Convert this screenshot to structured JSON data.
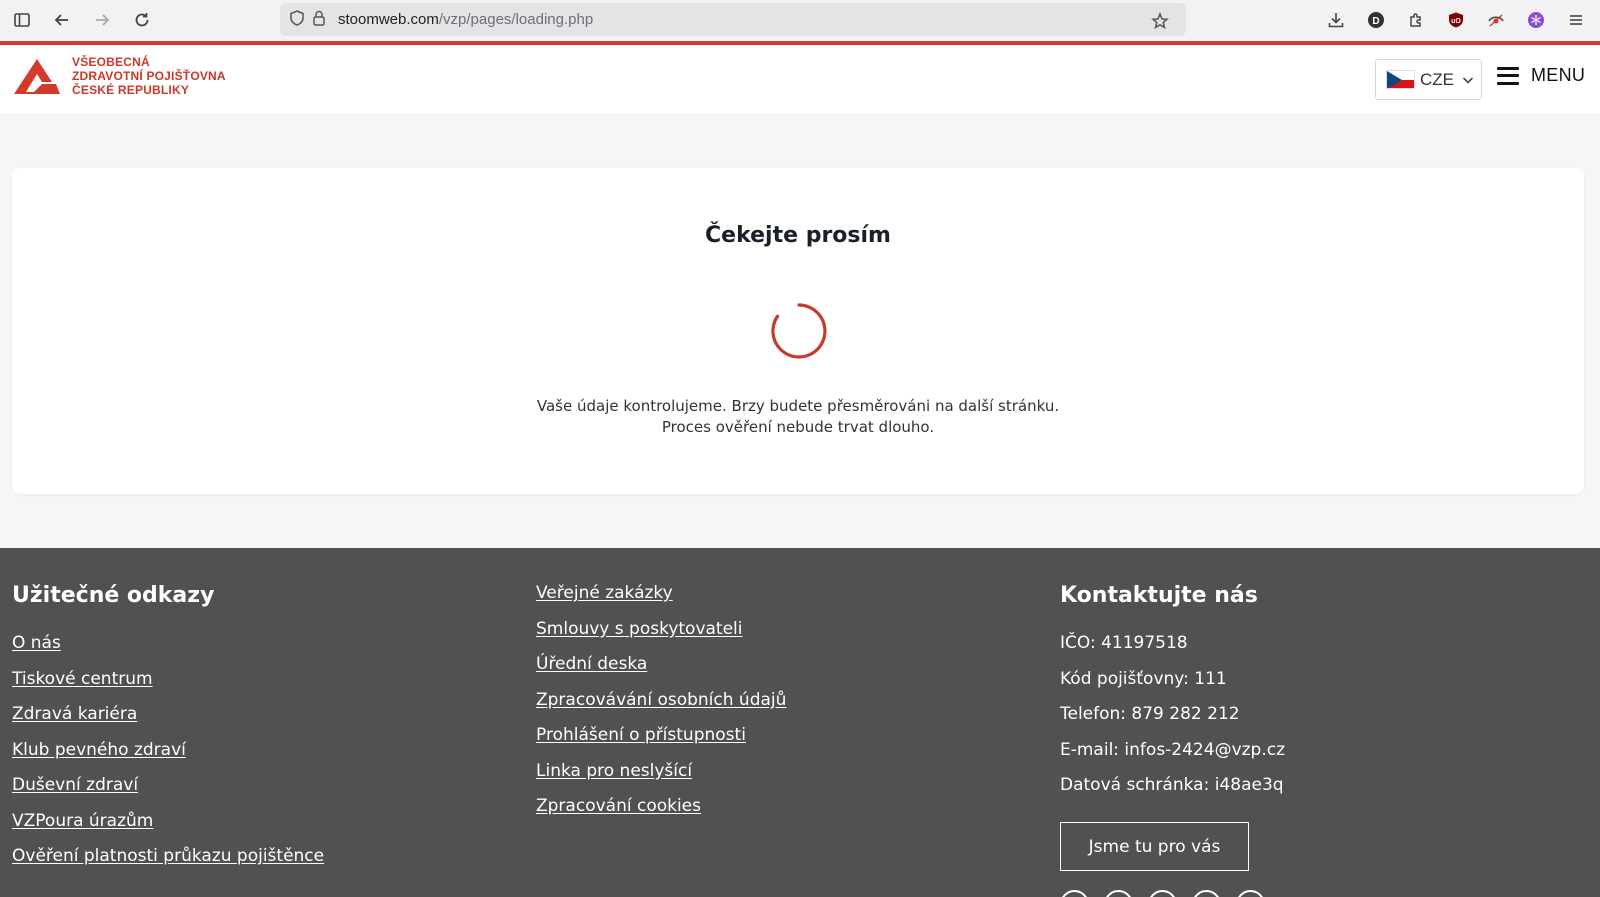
{
  "browser": {
    "url_domain": "stoomweb.com",
    "url_path": "/vzp/pages/loading.php",
    "profile_letter": "D"
  },
  "header": {
    "logo_lines": [
      "VŠEOBECNÁ",
      "ZDRAVOTNÍ POJIŠŤOVNA",
      "ČESKÉ REPUBLIKY"
    ],
    "language": "CZE",
    "menu_label": "MENU",
    "brand_color": "#d43a2a"
  },
  "card": {
    "title": "Čekejte prosím",
    "message_line1": "Vaše údaje kontrolujeme. Brzy budete přesměrováni na další stránku.",
    "message_line2": "Proces ověření nebude trvat dlouho."
  },
  "footer": {
    "useful_links_heading": "Užitečné odkazy",
    "useful_links": [
      "O nás",
      "Tiskové centrum",
      "Zdravá kariéra",
      "Klub pevného zdraví",
      "Duševní zdraví",
      "VZPoura úrazům",
      "Ověření platnosti průkazu pojištěnce"
    ],
    "more_links": [
      "Veřejné zakázky",
      "Smlouvy s poskytovateli",
      "Úřední deska",
      "Zpracovávání osobních údajů",
      "Prohlášení o přístupnosti",
      "Linka pro neslyšící",
      "Zpracování cookies"
    ],
    "contact_heading": "Kontaktujte nás",
    "contact_lines": [
      "IČO: 41197518",
      "Kód pojišťovny: 111",
      "Telefon: 879 282 212",
      "E-mail: infos-2424@vzp.cz",
      "Datová schránka: i48ae3q"
    ],
    "cta_label": "Jsme tu pro vás",
    "background_color": "#515151"
  }
}
